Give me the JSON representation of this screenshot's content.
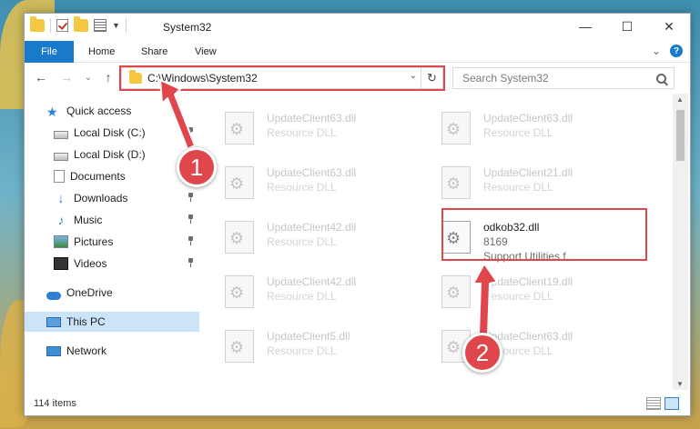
{
  "window": {
    "title": "System32",
    "controls": {
      "minimize": "—",
      "maximize": "☐",
      "close": "✕"
    }
  },
  "ribbon": {
    "tabs": [
      "File",
      "Home",
      "Share",
      "View"
    ],
    "expand_glyph": "⌄",
    "help_glyph": "?"
  },
  "nav": {
    "back": "←",
    "forward": "→",
    "recent": "⌄",
    "up": "↑",
    "address": "C:\\Windows\\System32",
    "address_dropdown": "⌄",
    "refresh": "↻",
    "search_placeholder": "Search System32"
  },
  "sidebar": {
    "items": [
      {
        "label": "Quick access",
        "icon": "star-icon",
        "pinned": false
      },
      {
        "label": "Local Disk (C:)",
        "icon": "disk-icon",
        "pinned": true
      },
      {
        "label": "Local Disk (D:)",
        "icon": "disk-icon",
        "pinned": false
      },
      {
        "label": "Documents",
        "icon": "documents-icon",
        "pinned": false
      },
      {
        "label": "Downloads",
        "icon": "downloads-icon",
        "pinned": true
      },
      {
        "label": "Music",
        "icon": "music-icon",
        "pinned": true
      },
      {
        "label": "Pictures",
        "icon": "pictures-icon",
        "pinned": true
      },
      {
        "label": "Videos",
        "icon": "videos-icon",
        "pinned": true
      },
      {
        "label": "OneDrive",
        "icon": "onedrive-icon",
        "pinned": false
      },
      {
        "label": "This PC",
        "icon": "this-pc-icon",
        "pinned": false,
        "selected": true
      },
      {
        "label": "Network",
        "icon": "network-icon",
        "pinned": false
      }
    ]
  },
  "files": {
    "left": [
      {
        "name": "UpdateClient63.dll",
        "desc": "Resource DLL"
      },
      {
        "name": "UpdateClient63.dll",
        "desc": "Resource DLL"
      },
      {
        "name": "UpdateClient42.dll",
        "desc": "Resource DLL"
      },
      {
        "name": "UpdateClient42.dll",
        "desc": "Resource DLL"
      },
      {
        "name": "UpdateClient5.dll",
        "desc": "Resource DLL"
      }
    ],
    "right": [
      {
        "name": "UpdateClient63.dll",
        "desc": "Resource DLL"
      },
      {
        "name": "UpdateClient21.dll",
        "desc": "Resource DLL"
      },
      {
        "name": "odkob32.dll",
        "size": "8169",
        "desc": "Support Utilities f...",
        "active": true
      },
      {
        "name": "UpdateClient19.dll",
        "desc": "Resource DLL"
      },
      {
        "name": "UpdateClient63.dll",
        "desc": "Resource DLL"
      }
    ]
  },
  "status": {
    "item_count": "114 items"
  },
  "annotations": {
    "step1": "1",
    "step2": "2",
    "color": "#e0474c"
  },
  "colors": {
    "accent": "#1979ca",
    "selected": "#cce4f7",
    "highlight": "#e0474c"
  }
}
